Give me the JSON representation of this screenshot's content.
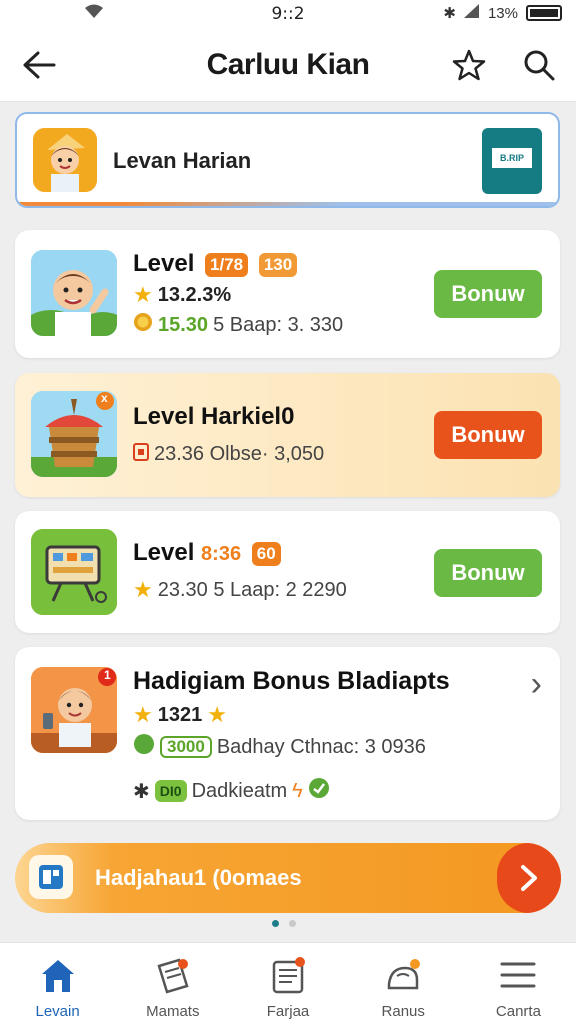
{
  "status": {
    "time": "9::2",
    "battery": "13%"
  },
  "header": {
    "title": "Carluu Kian"
  },
  "banner": {
    "label": "Levan Harian",
    "qr_text": "B.RIP"
  },
  "cards": [
    {
      "title": "Level",
      "pill1": "1/78",
      "pill2": "130",
      "rating": "13.2.3%",
      "coins": "15.30",
      "detail": "5 Baap: 3. 330",
      "button": "Bonuw"
    },
    {
      "title": "Level Harkiel0",
      "detail": "23.36 Olbse· 3,050",
      "badge": "x",
      "button": "Bonuw"
    },
    {
      "title": "Level",
      "pill1": "8:36",
      "pill2": "60",
      "detail": "23.30 5 Laap: 2 2290",
      "button": "Bonuw"
    },
    {
      "title": "Hadigiam  Bonus Bladiapts",
      "rating": "1321",
      "pill": "3000",
      "detail": "Badhay Cthnac: 3 0936",
      "tag": "DI0",
      "tag_text": "Dadkieatm",
      "badge": "1"
    }
  ],
  "promo": {
    "text": "Hadjahau1 (0omaes"
  },
  "tabs": [
    {
      "label": "Levain"
    },
    {
      "label": "Mamats"
    },
    {
      "label": "Farjaa"
    },
    {
      "label": "Ranus"
    },
    {
      "label": "Canrta"
    }
  ]
}
